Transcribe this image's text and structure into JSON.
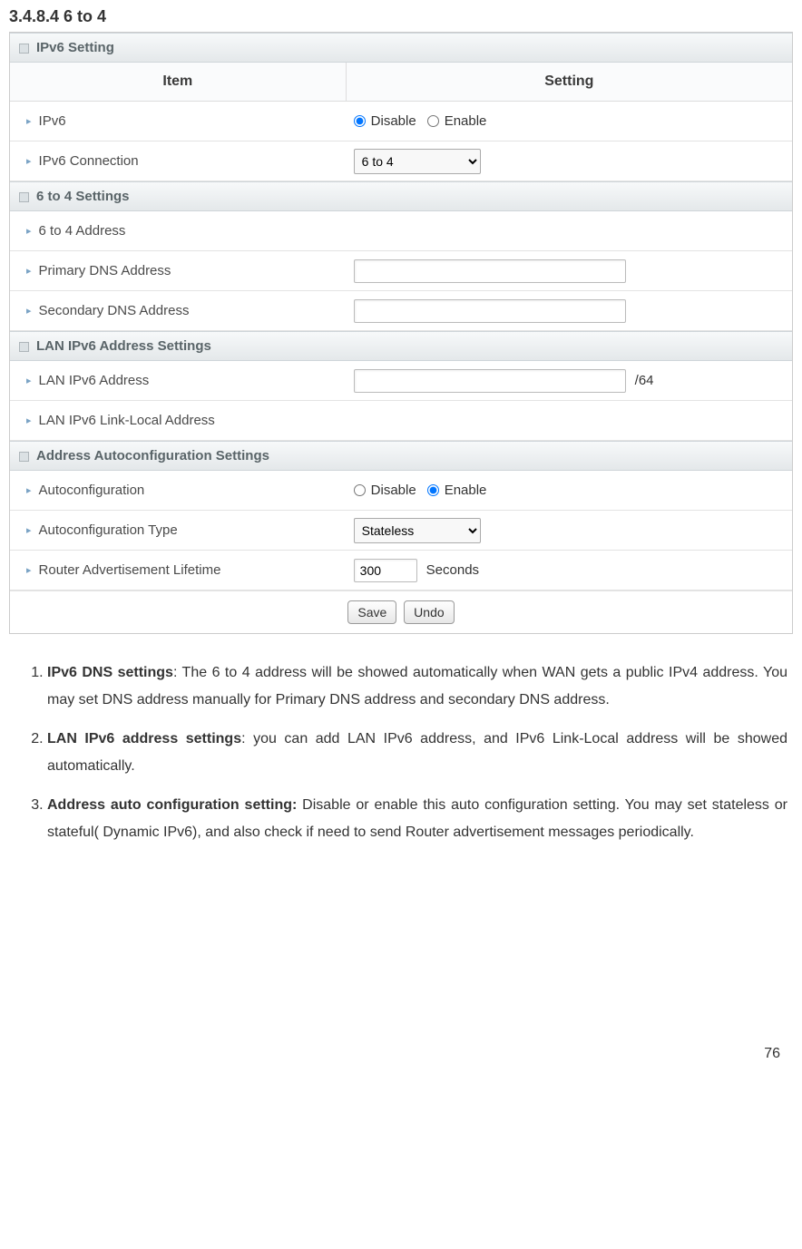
{
  "doc": {
    "heading": "3.4.8.4 6 to 4",
    "page_number": "76"
  },
  "panel": {
    "sections": {
      "ipv6": {
        "title": "IPv6 Setting"
      },
      "sixto4": {
        "title": "6 to 4 Settings"
      },
      "lan": {
        "title": "LAN IPv6 Address Settings"
      },
      "auto": {
        "title": "Address Autoconfiguration Settings"
      }
    },
    "colheaders": {
      "item": "Item",
      "setting": "Setting"
    },
    "rows": {
      "ipv6": {
        "label": "IPv6",
        "disable": "Disable",
        "enable": "Enable",
        "selected": "disable"
      },
      "ipv6conn": {
        "label": "IPv6 Connection",
        "value": "6 to 4"
      },
      "sixto4addr": {
        "label": "6 to 4 Address",
        "value": ""
      },
      "pdns": {
        "label": "Primary DNS Address",
        "value": ""
      },
      "sdns": {
        "label": "Secondary DNS Address",
        "value": ""
      },
      "lanaddr": {
        "label": "LAN IPv6 Address",
        "value": "",
        "suffix": "/64"
      },
      "lanlocal": {
        "label": "LAN IPv6 Link-Local Address",
        "value": ""
      },
      "autoconf": {
        "label": "Autoconfiguration",
        "disable": "Disable",
        "enable": "Enable",
        "selected": "enable"
      },
      "autotype": {
        "label": "Autoconfiguration Type",
        "value": "Stateless"
      },
      "ral": {
        "label": "Router Advertisement Lifetime",
        "value": "300",
        "unit": "Seconds"
      }
    },
    "buttons": {
      "save": "Save",
      "undo": "Undo"
    }
  },
  "notes": {
    "n1": {
      "bold": "IPv6 DNS settings",
      "rest": ": The 6 to 4 address will be showed automatically when WAN gets a public IPv4 address. You may set DNS address manually for Primary DNS address and secondary DNS address."
    },
    "n2": {
      "bold": "LAN IPv6 address settings",
      "rest": ": you can add LAN IPv6 address, and IPv6 Link-Local address will be showed automatically."
    },
    "n3": {
      "bold": "Address auto configuration setting:",
      "rest": " Disable or enable this auto configuration setting. You may set stateless or stateful( Dynamic IPv6), and also check if need to send Router advertisement messages periodically."
    }
  }
}
